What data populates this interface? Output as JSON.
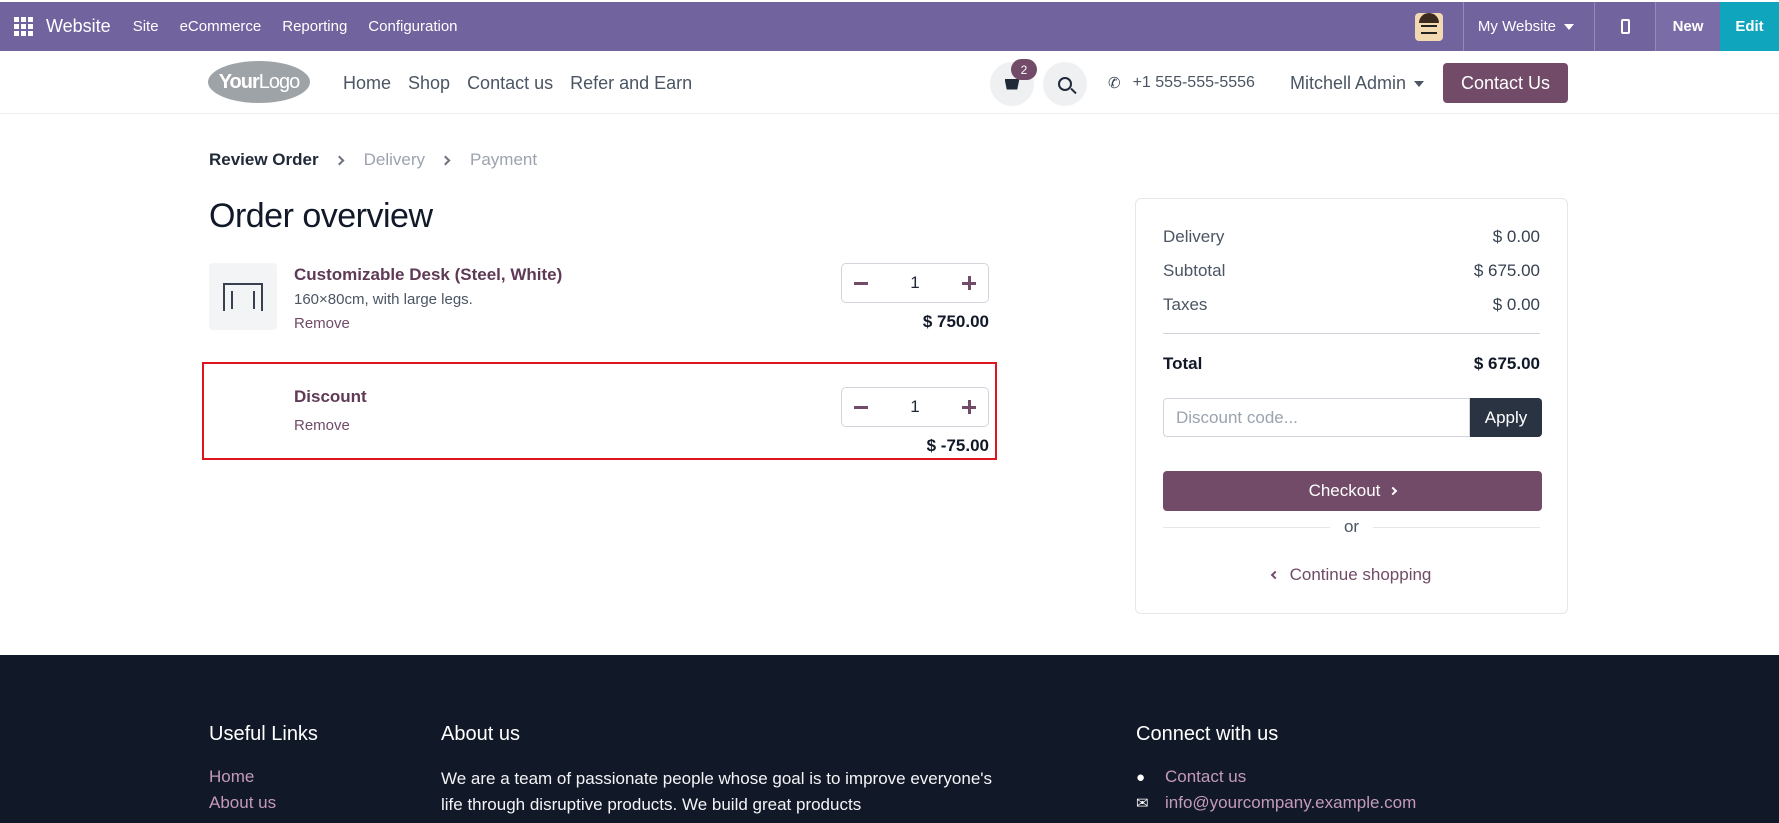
{
  "admin_bar": {
    "brand": "Website",
    "menu": [
      "Site",
      "eCommerce",
      "Reporting",
      "Configuration"
    ],
    "website_selector": "My Website",
    "new_label": "New",
    "edit_label": "Edit"
  },
  "header": {
    "logo_bold": "Your",
    "logo_light": "Logo",
    "nav": [
      "Home",
      "Shop",
      "Contact us",
      "Refer and Earn"
    ],
    "cart_count": "2",
    "phone": "+1 555-555-5556",
    "user": "Mitchell Admin",
    "contact_button": "Contact Us"
  },
  "steps": [
    "Review Order",
    "Delivery",
    "Payment"
  ],
  "page_title": "Order overview",
  "lines": [
    {
      "name": "Customizable Desk (Steel, White)",
      "description": "160×80cm, with large legs.",
      "remove": "Remove",
      "qty": "1",
      "price": "$ 750.00"
    },
    {
      "name": "Discount",
      "remove": "Remove",
      "qty": "1",
      "price": "$ -75.00"
    }
  ],
  "summary": {
    "delivery_label": "Delivery",
    "delivery_value": "$ 0.00",
    "subtotal_label": "Subtotal",
    "subtotal_value": "$ 675.00",
    "taxes_label": "Taxes",
    "taxes_value": "$ 0.00",
    "total_label": "Total",
    "total_value": "$ 675.00",
    "discount_placeholder": "Discount code...",
    "apply_label": "Apply",
    "checkout_label": "Checkout",
    "or_label": "or",
    "continue_label": "Continue shopping"
  },
  "footer": {
    "useful_links_title": "Useful Links",
    "useful_links": [
      "Home",
      "About us"
    ],
    "about_title": "About us",
    "about_text": "We are a team of passionate people whose goal is to improve everyone's life through disruptive products. We build great products",
    "connect_title": "Connect with us",
    "connect_items": [
      "Contact us",
      "info@yourcompany.example.com"
    ]
  },
  "colors": {
    "admin_bar": "#71639e",
    "primary": "#714b67",
    "edit": "#0fa6bd",
    "highlight": "#e0141e",
    "footer": "#111827"
  }
}
